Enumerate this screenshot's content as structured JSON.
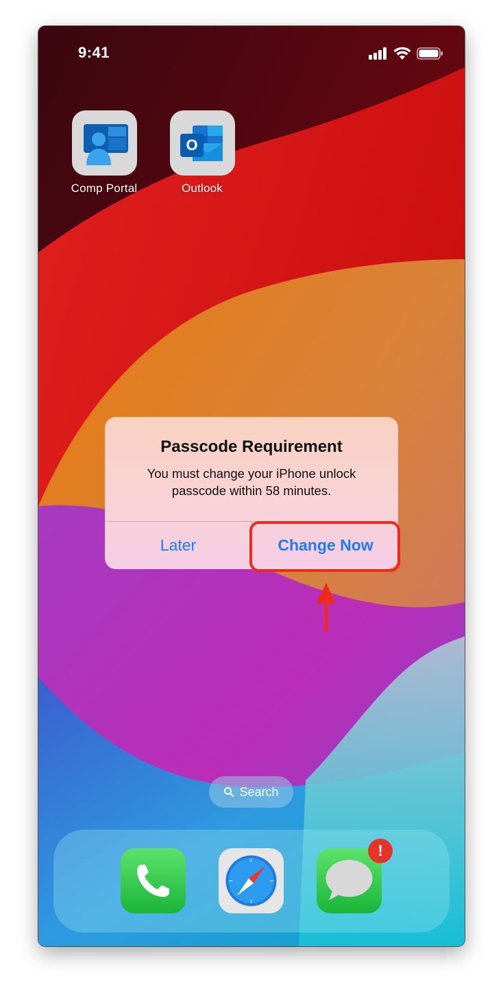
{
  "status_bar": {
    "time": "9:41"
  },
  "home_apps": [
    {
      "label": "Comp Portal",
      "icon": "company-portal-icon"
    },
    {
      "label": "Outlook",
      "icon": "outlook-icon"
    }
  ],
  "alert": {
    "title": "Passcode Requirement",
    "message": "You must change your iPhone unlock passcode within 58 minutes.",
    "buttons": {
      "later": "Later",
      "change_now": "Change Now"
    }
  },
  "search": {
    "label": "Search"
  },
  "dock": {
    "apps": [
      {
        "name": "Phone",
        "icon": "phone-icon"
      },
      {
        "name": "Safari",
        "icon": "safari-icon"
      },
      {
        "name": "Messages",
        "icon": "messages-icon"
      }
    ],
    "badge": "!"
  },
  "colors": {
    "accent": "#1e7cf2",
    "highlight": "#f02a1a",
    "badge": "#e5352b"
  }
}
